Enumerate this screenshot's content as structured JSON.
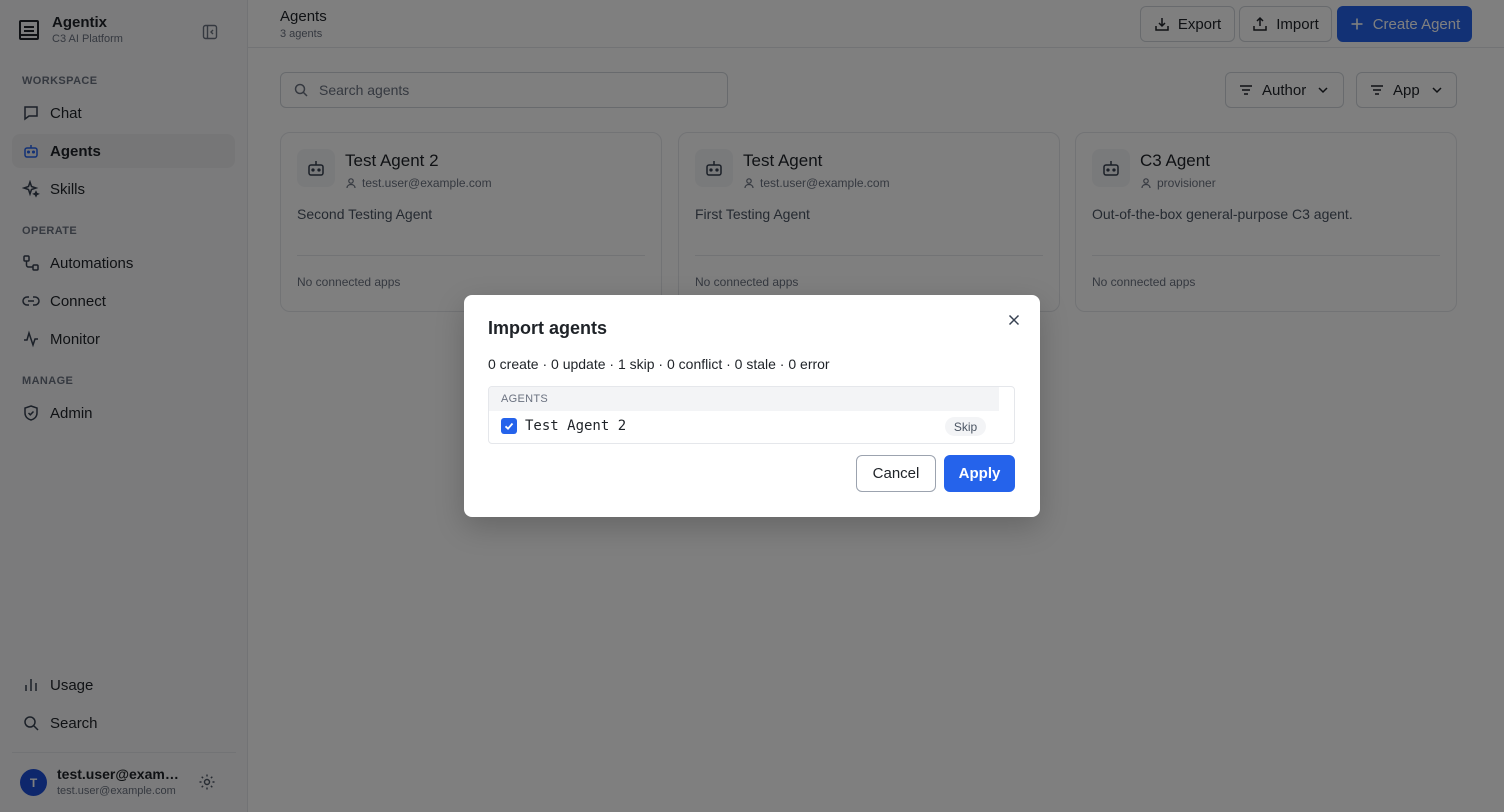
{
  "brand": {
    "name": "Agentix",
    "subtitle": "C3 AI Platform"
  },
  "sidebar": {
    "sections": [
      {
        "label": "WORKSPACE"
      },
      {
        "label": "OPERATE"
      },
      {
        "label": "MANAGE"
      }
    ],
    "items": [
      {
        "label": "Chat",
        "icon": "chat-icon"
      },
      {
        "label": "Agents",
        "icon": "bot-icon",
        "active": true
      },
      {
        "label": "Skills",
        "icon": "sparkles-icon"
      },
      {
        "label": "Automations",
        "icon": "workflow-icon"
      },
      {
        "label": "Connect",
        "icon": "link-icon"
      },
      {
        "label": "Monitor",
        "icon": "activity-icon"
      },
      {
        "label": "Admin",
        "icon": "shield-icon"
      },
      {
        "label": "Usage",
        "icon": "bar-chart-icon"
      },
      {
        "label": "Search",
        "icon": "search-icon"
      }
    ],
    "user": {
      "initial": "T",
      "name": "test.user@example.com",
      "email": "test.user@example.com"
    }
  },
  "header": {
    "title": "Agents",
    "subtitle": "3 agents",
    "export_label": "Export",
    "import_label": "Import",
    "create_label": "Create Agent"
  },
  "search": {
    "placeholder": "Search agents",
    "value": ""
  },
  "filters": {
    "author_label": "Author",
    "app_label": "App"
  },
  "agents": [
    {
      "name": "Test Agent 2",
      "author": "test.user@example.com",
      "description": "Second Testing Agent",
      "apps": "No connected apps"
    },
    {
      "name": "Test Agent",
      "author": "test.user@example.com",
      "description": "First Testing Agent",
      "apps": "No connected apps"
    },
    {
      "name": "C3 Agent",
      "author": "provisioner",
      "description": "Out-of-the-box general-purpose C3 agent.",
      "apps": "No connected apps"
    }
  ],
  "modal": {
    "title": "Import agents",
    "summary": "0 create · 0 update · 1 skip · 0 conflict · 0 stale · 0 error",
    "list_header": "AGENTS",
    "rows": [
      {
        "name": "Test Agent 2",
        "checked": true,
        "status": "Skip"
      }
    ],
    "cancel_label": "Cancel",
    "apply_label": "Apply"
  },
  "colors": {
    "primary": "#2563eb",
    "avatar": "#1d4ed8"
  }
}
